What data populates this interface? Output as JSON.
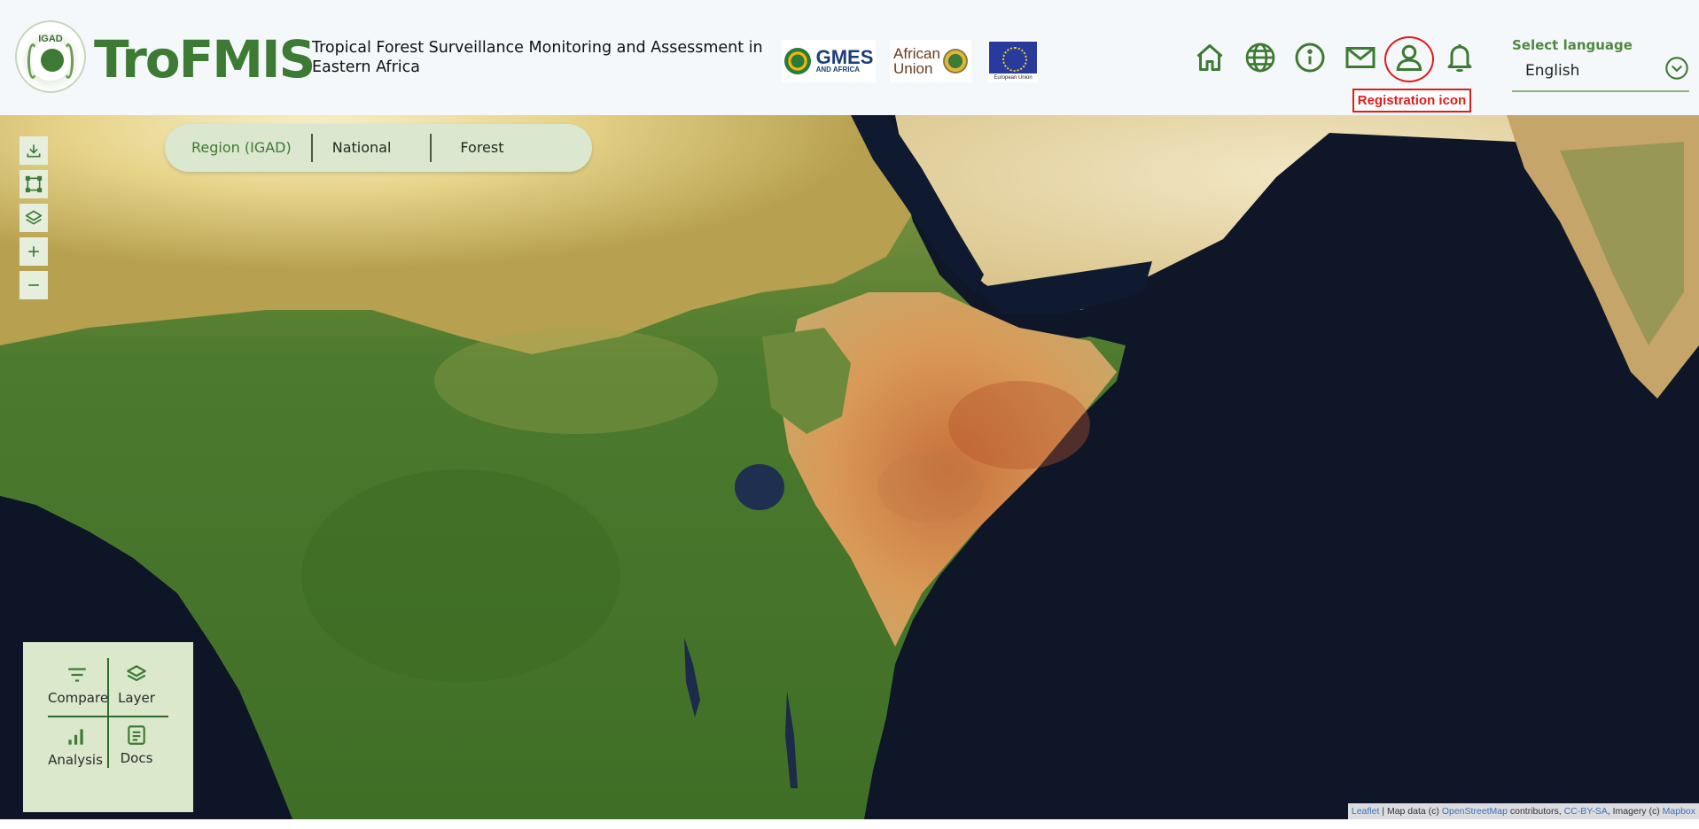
{
  "header": {
    "logo_text": "IGAD",
    "brand": "TroFMIS",
    "tagline": "Tropical Forest Surveillance Monitoring and Assessment in Eastern Africa",
    "partners": {
      "gmes_main": "GMES",
      "gmes_sub": "AND AFRICA",
      "au_line1": "African",
      "au_line2": "Union",
      "eu_label": "European Union"
    },
    "nav_icons": [
      "home-icon",
      "globe-icon",
      "info-icon",
      "mail-icon",
      "user-icon",
      "bell-icon"
    ],
    "registration_annotation": "Registration icon",
    "language": {
      "label": "Select language",
      "value": "English"
    }
  },
  "map": {
    "scope_tabs": [
      {
        "label": "Region (IGAD)",
        "active": true
      },
      {
        "label": "National",
        "active": false
      },
      {
        "label": "Forest",
        "active": false
      }
    ],
    "tools": [
      "download-icon",
      "draw-rectangle-icon",
      "layers-icon",
      "zoom-in-icon",
      "zoom-out-icon"
    ],
    "panel": {
      "compare": "Compare",
      "layer": "Layer",
      "analysis": "Analysis",
      "docs": "Docs"
    },
    "attribution": {
      "leaflet": "Leaflet",
      "text1": " | Map data (c) ",
      "osm": "OpenStreetMap",
      "text2": " contributors, ",
      "license": "CC-BY-SA",
      "text3": ", Imagery (c) ",
      "mapbox": "Mapbox"
    }
  },
  "colors": {
    "brand_green": "#3d7a34",
    "annotation_red": "#e11b1b",
    "panel_green": "#dbe8cc"
  }
}
